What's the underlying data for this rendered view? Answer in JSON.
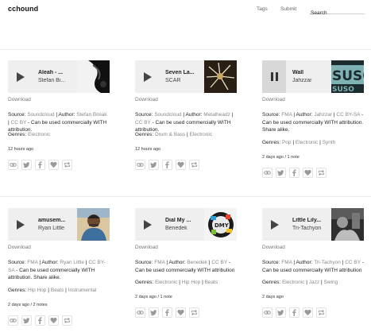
{
  "header": {
    "logo": "cchound",
    "nav": {
      "tags": "Tags",
      "submit": "Submit"
    },
    "search": {
      "placeholder": "Search"
    }
  },
  "common": {
    "download": "Download"
  },
  "cards": [
    {
      "title": "Aleah - ...",
      "artist": "Stefan Bi...",
      "state": "paused",
      "source": "Soundcloud",
      "author": "Stefan Biniak",
      "license": "CC BY",
      "license_text": "- Can be used commercially WITH attribution.",
      "genres": [
        "Electronic"
      ],
      "time": "12 hours ago",
      "notes": ""
    },
    {
      "title": "Seven La...",
      "artist": "SCAR",
      "state": "paused",
      "source": "Soundcloud",
      "author": "Metalheadz",
      "license": "CC BY",
      "license_text": "- Can be used commercially WITH attribution.",
      "genres": [
        "Drum & Bass",
        "Electronic"
      ],
      "time": "12 hours ago",
      "notes": ""
    },
    {
      "title": "Wall",
      "artist": "Jahzzar",
      "state": "playing",
      "source": "FMA",
      "author": "Jahzzar",
      "license": "CC BY-SA",
      "license_text": "- Can be used commercially WITH attribution. Share alike.",
      "genres": [
        "Pop",
        "Electronic",
        "Synth"
      ],
      "time": "2 days ago",
      "notes": "1 note"
    },
    {
      "title": "amusem...",
      "artist": "Ryan Little",
      "state": "paused",
      "source": "FMA",
      "author": "Ryan Little",
      "license": "CC BY-SA",
      "license_text": "- Can be used commercially WITH attribution. Share alike.",
      "genres": [
        "Hip Hop",
        "Beats",
        "Instrumental"
      ],
      "time": "2 days ago",
      "notes": "2 notes"
    },
    {
      "title": "Dial My ...",
      "artist": "Benedek",
      "state": "paused",
      "source": "FMA",
      "author": "Benedek",
      "license": "CC BY",
      "license_text": "- Can be used commercially WITH attribution",
      "genres": [
        "Electronic",
        "Hip Hop",
        "Beats"
      ],
      "time": "2 days ago",
      "notes": "1 note"
    },
    {
      "title": "Little Lily...",
      "artist": "Tri-Tachyon",
      "state": "paused",
      "source": "FMA",
      "author": "Tri-Tachyon",
      "license": "CC BY",
      "license_text": "- Can be used commercially WITH attribution",
      "genres": [
        "Electronic",
        "Jazz",
        "Swing"
      ],
      "time": "2 days ago",
      "notes": ""
    }
  ],
  "icon_names": [
    "link-icon",
    "twitter-icon",
    "facebook-icon",
    "heart-icon",
    "reblog-icon"
  ],
  "colors": {
    "link": "#888888",
    "player_bg": "#efefef",
    "play_icon": "#444444"
  }
}
